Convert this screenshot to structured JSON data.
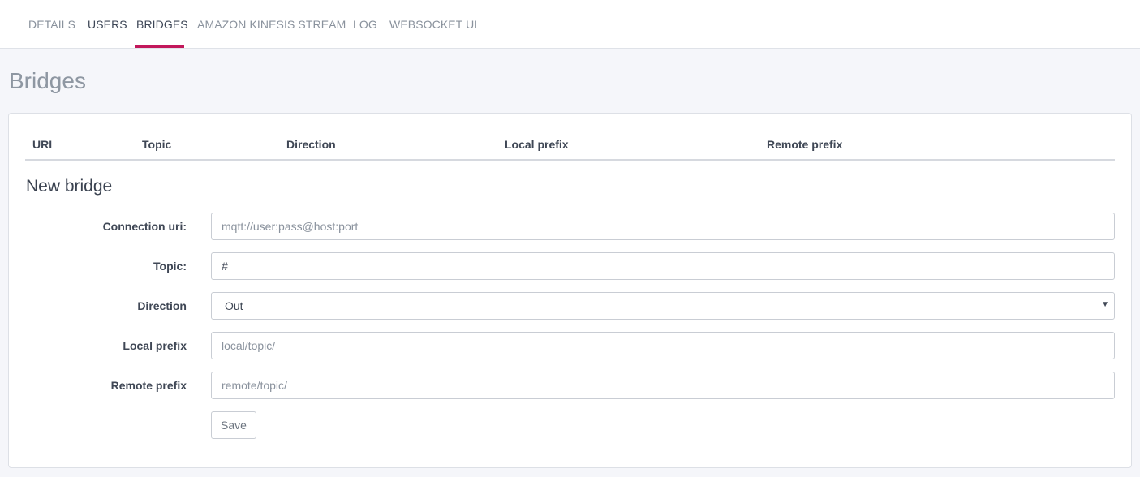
{
  "tabs": [
    {
      "label": "DETAILS"
    },
    {
      "label": "USERS"
    },
    {
      "label": "BRIDGES",
      "active": true
    },
    {
      "label": "AMAZON KINESIS STREAM"
    },
    {
      "label": "LOG"
    },
    {
      "label": "WEBSOCKET UI"
    }
  ],
  "colors": {
    "accent": "#c2185b",
    "title": "#8e97a2",
    "background": "#f5f6fa"
  },
  "page": {
    "title": "Bridges"
  },
  "table": {
    "columns": [
      "URI",
      "Topic",
      "Direction",
      "Local prefix",
      "Remote prefix"
    ],
    "rows": []
  },
  "form": {
    "title": "New bridge",
    "connection_uri": {
      "label": "Connection uri:",
      "placeholder": "mqtt://user:pass@host:port",
      "value": ""
    },
    "topic": {
      "label": "Topic:",
      "value": "#"
    },
    "direction": {
      "label": "Direction",
      "selected": "Out",
      "icon": "chevron-down-icon"
    },
    "local_prefix": {
      "label": "Local prefix",
      "placeholder": "local/topic/",
      "value": ""
    },
    "remote_prefix": {
      "label": "Remote prefix",
      "placeholder": "remote/topic/",
      "value": ""
    },
    "save_label": "Save"
  }
}
